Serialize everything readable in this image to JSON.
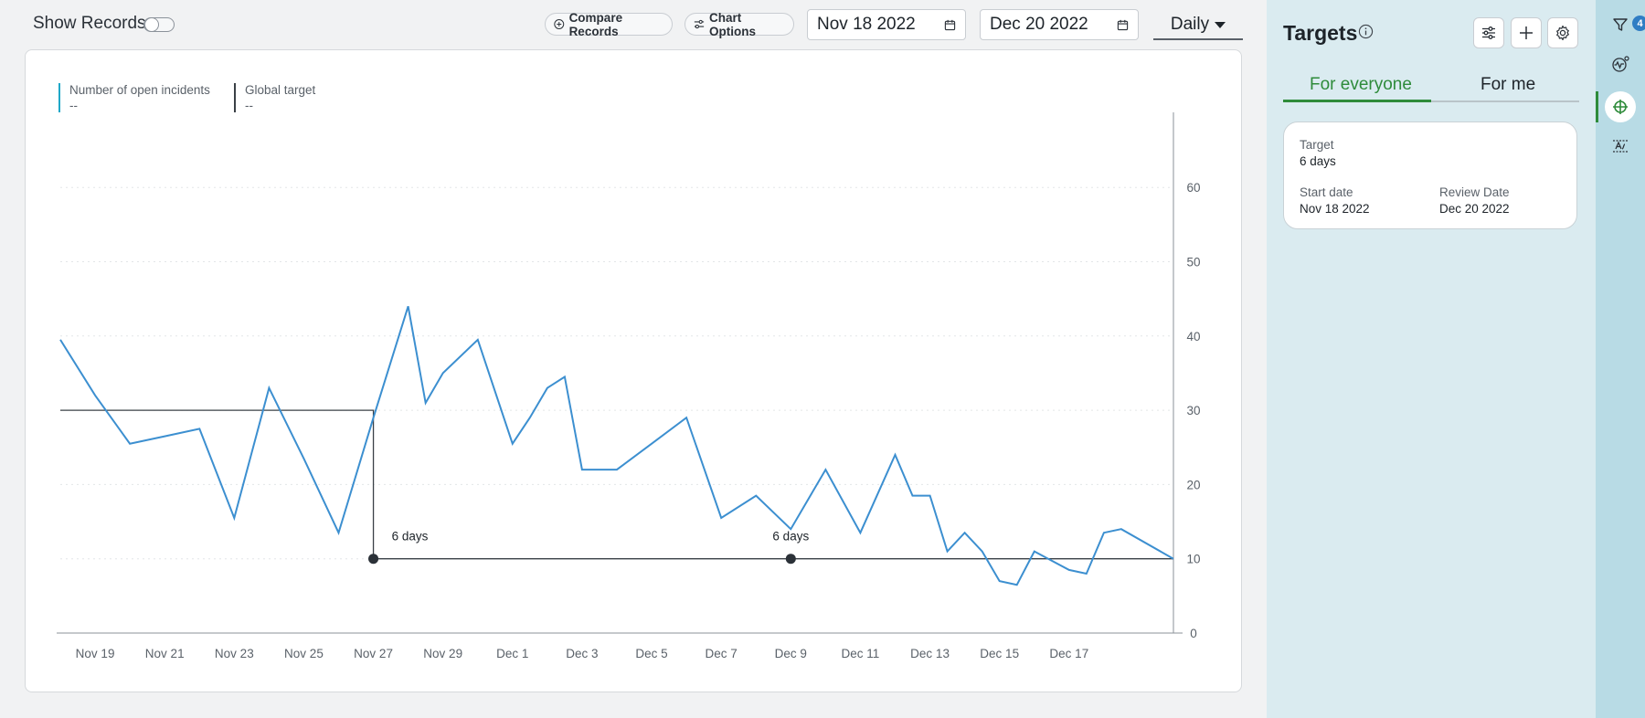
{
  "toolbar": {
    "show_records_label": "Show Records",
    "show_records_on": false,
    "compare_records_label": "Compare Records",
    "chart_options_label": "Chart Options",
    "start_date": "Nov 18 2022",
    "end_date": "Dec 20 2022",
    "interval": "Daily"
  },
  "legend": [
    {
      "label": "Number of open incidents",
      "value": "--",
      "color": "#1fa8c8"
    },
    {
      "label": "Global target",
      "value": "--",
      "color": "#3a4046"
    }
  ],
  "chart_data": {
    "type": "line",
    "x_tick_labels": [
      "Nov 19",
      "Nov 21",
      "Nov 23",
      "Nov 25",
      "Nov 27",
      "Nov 29",
      "Dec 1",
      "Dec 3",
      "Dec 5",
      "Dec 7",
      "Dec 9",
      "Dec 11",
      "Dec 13",
      "Dec 15",
      "Dec 17"
    ],
    "y_ticks": [
      0,
      10,
      20,
      30,
      40,
      50,
      60
    ],
    "ylim": [
      0,
      70
    ],
    "y_axis_position": "right",
    "grid": "dotted horizontal",
    "series": [
      {
        "color": "#3c8fd0",
        "points": [
          [
            "Nov 18",
            39.5
          ],
          [
            "Nov 19",
            32
          ],
          [
            "Nov 20",
            25.5
          ],
          [
            "Nov 21",
            26.5
          ],
          [
            "Nov 22",
            27.5
          ],
          [
            "Nov 23",
            15.5
          ],
          [
            "Nov 24",
            33
          ],
          [
            "Nov 25",
            23.5
          ],
          [
            "Nov 26",
            13.5
          ],
          [
            "Nov 27",
            29
          ],
          [
            "Nov 28",
            44
          ],
          [
            "Nov 28b",
            31
          ],
          [
            "Nov 29",
            35
          ],
          [
            "Nov 30",
            39.5
          ],
          [
            "Dec 1a",
            25.5
          ],
          [
            "Dec 1b",
            29
          ],
          [
            "Dec 2",
            33
          ],
          [
            "Dec 2b",
            34.5
          ],
          [
            "Dec 3",
            22
          ],
          [
            "Dec 4",
            22
          ],
          [
            "Dec 5",
            25.5
          ],
          [
            "Dec 6",
            29
          ],
          [
            "Dec 7",
            15.5
          ],
          [
            "Dec 8",
            18.5
          ],
          [
            "Dec 9",
            14
          ],
          [
            "Dec 10",
            22
          ],
          [
            "Dec 11",
            13.5
          ],
          [
            "Dec 12",
            24
          ],
          [
            "Dec 12b",
            18.5
          ],
          [
            "Dec 13",
            18.5
          ],
          [
            "Dec 13b",
            11
          ],
          [
            "Dec 14",
            13.5
          ],
          [
            "Dec 14b",
            11
          ],
          [
            "Dec 15",
            7
          ],
          [
            "Dec 15b",
            6.5
          ],
          [
            "Dec 16",
            11
          ],
          [
            "Dec 17",
            8.5
          ],
          [
            "Dec 17b",
            8
          ],
          [
            "Dec 18",
            13.5
          ],
          [
            "Dec 18b",
            14
          ],
          [
            "Dec 20",
            10
          ]
        ]
      }
    ],
    "target_line": {
      "color": "#3a4046",
      "steps": [
        {
          "from": "Nov 18",
          "to": "Nov 27",
          "value": 30
        },
        {
          "from": "Nov 27",
          "to": "Dec 20",
          "value": 10
        }
      ],
      "markers": [
        {
          "at": "Nov 27",
          "value": 10,
          "label": "6 days"
        },
        {
          "at": "Dec 9",
          "value": 10,
          "label": "6 days"
        }
      ]
    }
  },
  "targets_panel": {
    "title": "Targets",
    "tabs": [
      {
        "label": "For everyone",
        "active": true
      },
      {
        "label": "For me",
        "active": false
      }
    ],
    "card": {
      "target_label": "Target",
      "target_value": "6 days",
      "start_label": "Start date",
      "start_value": "Nov 18 2022",
      "review_label": "Review Date",
      "review_value": "Dec 20 2022"
    }
  },
  "right_rail": {
    "filter_badge": "4",
    "icons": [
      "filter-icon",
      "analytics-icon",
      "target-icon",
      "formula-icon"
    ],
    "active": "target-icon"
  },
  "colors": {
    "accent_green": "#2e8b3a",
    "series_blue": "#3c8fd0",
    "panel_bg": "#daebf0",
    "rail_bg": "#b8dbe5"
  }
}
